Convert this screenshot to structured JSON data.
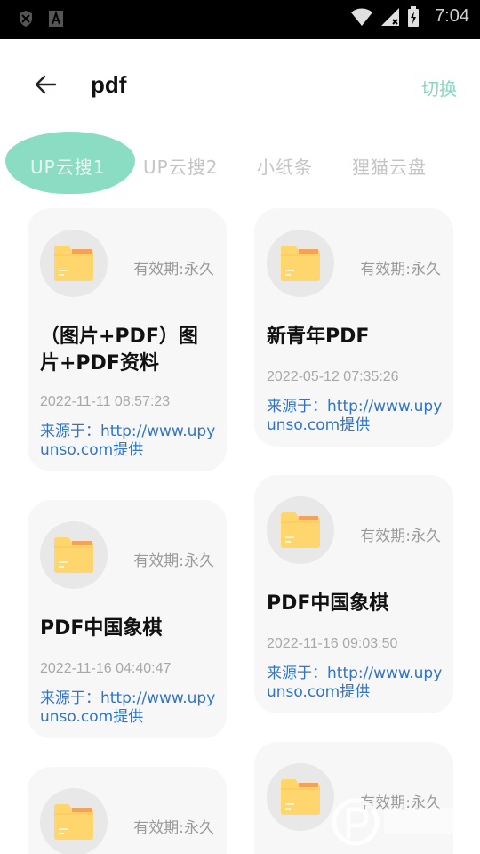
{
  "status_bar": {
    "time": "7:04",
    "icons": [
      "shield-icon",
      "a-icon",
      "wifi-icon",
      "signal-icon",
      "battery-icon"
    ]
  },
  "header": {
    "title": "pdf",
    "switch_label": "切换",
    "back_icon": "arrow-left-icon"
  },
  "tabs": [
    {
      "label": "UP云搜1",
      "active": true
    },
    {
      "label": "UP云搜2",
      "active": false
    },
    {
      "label": "小纸条",
      "active": false
    },
    {
      "label": "狸猫云盘",
      "active": false
    }
  ],
  "cards": [
    {
      "validity": "有效期:永久",
      "title": "（图片+PDF）图片+PDF资料",
      "date": "2022-11-11 08:57:23",
      "source": "来源于：http://www.upyunso.com提供"
    },
    {
      "validity": "有效期:永久",
      "title": "新青年PDF",
      "date": "2022-05-12 07:35:26",
      "source": "来源于：http://www.upyunso.com提供"
    },
    {
      "validity": "有效期:永久",
      "title": "PDF中国象棋",
      "date": "2022-11-16 04:40:47",
      "source": "来源于：http://www.upyunso.com提供"
    },
    {
      "validity": "有效期:永久",
      "title": "PDF中国象棋",
      "date": "2022-11-16 09:03:50",
      "source": "来源于：http://www.upyunso.com提供"
    },
    {
      "validity": "有效期:永久"
    },
    {
      "validity": "有效期:永久"
    }
  ],
  "colors": {
    "accent": "#8adcc3",
    "link": "#2f74c9",
    "folder": "#ffd66e"
  }
}
